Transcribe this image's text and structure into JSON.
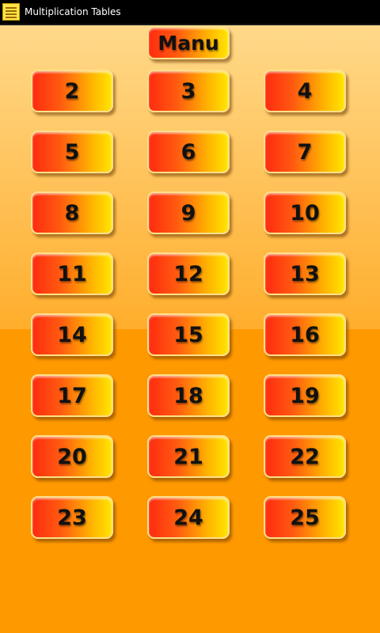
{
  "titlebar": {
    "title": "Multiplication Tables",
    "icon": "app-icon"
  },
  "menu": {
    "label": "Manu"
  },
  "tables": [
    "2",
    "3",
    "4",
    "5",
    "6",
    "7",
    "8",
    "9",
    "10",
    "11",
    "12",
    "13",
    "14",
    "15",
    "16",
    "17",
    "18",
    "19",
    "20",
    "21",
    "22",
    "23",
    "24",
    "25"
  ],
  "colors": {
    "button_left": "#ff2b10",
    "button_right": "#ffe500",
    "background_top": "#ffd98a",
    "background_bottom": "#ff9900"
  }
}
